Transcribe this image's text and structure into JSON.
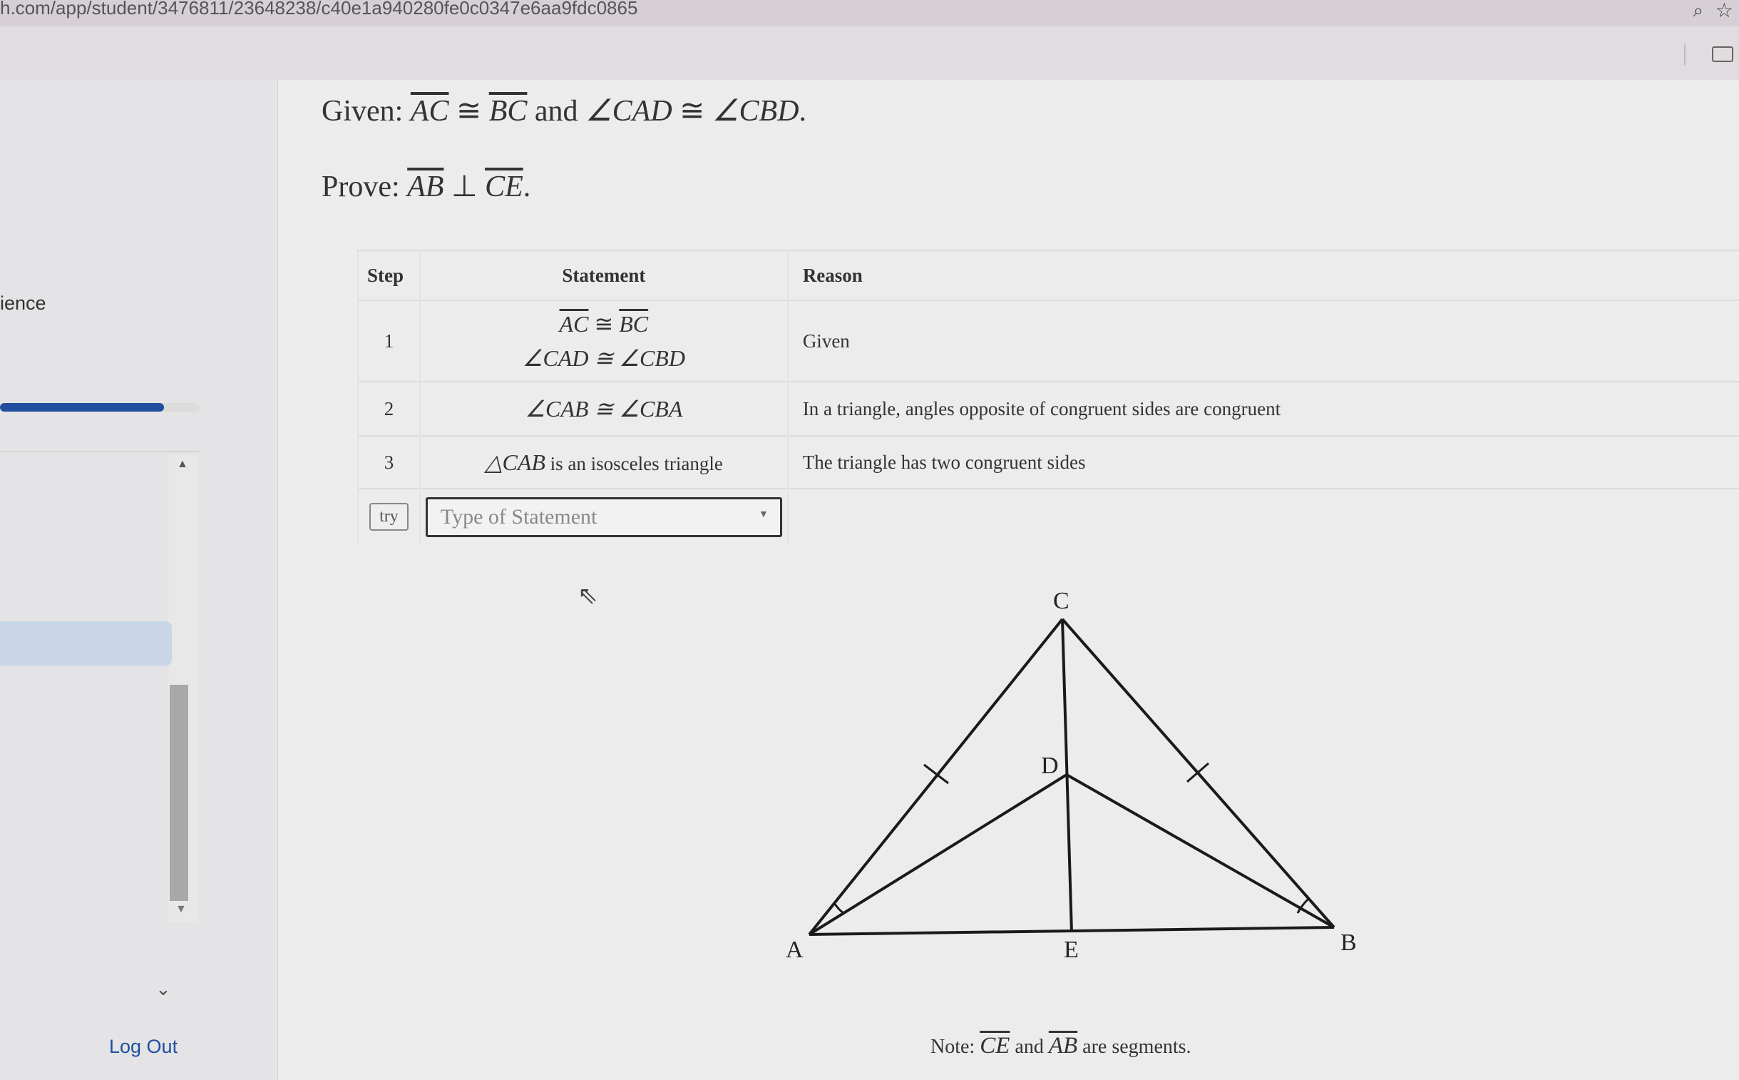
{
  "browser": {
    "url": "h.com/app/student/3476811/23648238/c40e1a940280fe0c0347e6aa9fdc0865"
  },
  "sidebar": {
    "partial_label": "ience",
    "progress_percent": 82,
    "logout": "Log Out"
  },
  "problem": {
    "given_label": "Given:",
    "given_seg1": "AC",
    "given_cong": "≅",
    "given_seg2": "BC",
    "given_and": "and",
    "given_ang1": "∠CAD",
    "given_ang2": "∠CBD",
    "given_end": ".",
    "prove_label": "Prove:",
    "prove_seg1": "AB",
    "prove_perp": "⊥",
    "prove_seg2": "CE",
    "prove_end": "."
  },
  "table": {
    "headers": {
      "step": "Step",
      "statement": "Statement",
      "reason": "Reason"
    },
    "rows": [
      {
        "step": "1",
        "statement_line1_a": "AC",
        "statement_line1_b": "BC",
        "statement_line2": "∠CAD ≅ ∠CBD",
        "reason": "Given"
      },
      {
        "step": "2",
        "statement": "∠CAB ≅ ∠CBA",
        "reason": "In a triangle, angles opposite of congruent sides are congruent"
      },
      {
        "step": "3",
        "statement_math": "△CAB",
        "statement_text": " is an isosceles triangle",
        "reason": "The triangle has two congruent sides"
      }
    ],
    "try_button": "try",
    "statement_select": {
      "placeholder": "Type of Statement"
    }
  },
  "diagram": {
    "labels": {
      "A": "A",
      "B": "B",
      "C": "C",
      "D": "D",
      "E": "E"
    }
  },
  "note": {
    "prefix": "Note:",
    "seg1": "CE",
    "and": "and",
    "seg2": "AB",
    "suffix": "are segments."
  }
}
